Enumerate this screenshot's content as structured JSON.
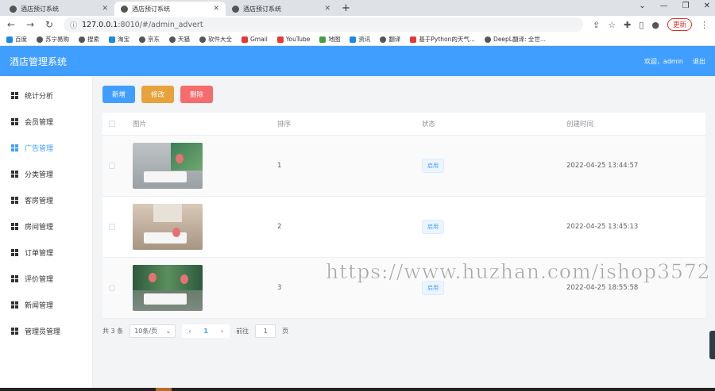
{
  "browser": {
    "tabs": [
      {
        "title": "酒店预订系统",
        "active": false
      },
      {
        "title": "酒店预订系统",
        "active": true
      },
      {
        "title": "酒店预订系统",
        "active": false
      }
    ],
    "new_tab": "+",
    "address": {
      "host": "127.0.0.1",
      "path": ":8010/#/admin_advert"
    },
    "update_label": "更新",
    "bookmarks": [
      "百度",
      "苏宁易购",
      "搜索",
      "淘宝",
      "京东",
      "天猫",
      "软件大全",
      "Gmail",
      "YouTube",
      "地图",
      "资讯",
      "翻译",
      "基于Python的天气...",
      "DeepL翻译: 全世..."
    ]
  },
  "app": {
    "title": "酒店管理系统",
    "welcome": "欢迎，admin",
    "logout": "退出"
  },
  "sidebar": {
    "items": [
      {
        "label": "统计分析",
        "active": false
      },
      {
        "label": "会员管理",
        "active": false
      },
      {
        "label": "广告管理",
        "active": true
      },
      {
        "label": "分类管理",
        "active": false
      },
      {
        "label": "客房管理",
        "active": false
      },
      {
        "label": "房间管理",
        "active": false
      },
      {
        "label": "订单管理",
        "active": false
      },
      {
        "label": "评价管理",
        "active": false
      },
      {
        "label": "新闻管理",
        "active": false
      },
      {
        "label": "管理员管理",
        "active": false
      }
    ]
  },
  "actions": {
    "add": "新增",
    "edit": "修改",
    "delete": "删除"
  },
  "table": {
    "columns": [
      "图片",
      "排序",
      "状态",
      "创建时间"
    ],
    "rows": [
      {
        "sort": "1",
        "status": "启用",
        "created": "2022-04-25 13:44:57"
      },
      {
        "sort": "2",
        "status": "启用",
        "created": "2022-04-25 13:45:13"
      },
      {
        "sort": "3",
        "status": "启用",
        "created": "2022-04-25 18:55:58"
      }
    ]
  },
  "pagination": {
    "total": "共 3 条",
    "page_size": "10条/页",
    "current": "1",
    "goto_label": "前往",
    "goto_value": "1",
    "page_suffix": "页"
  },
  "watermark": "https://www.huzhan.com/ishop3572",
  "colors": {
    "primary": "#409eff",
    "warning": "#e6a23c",
    "danger": "#f56c6c"
  }
}
